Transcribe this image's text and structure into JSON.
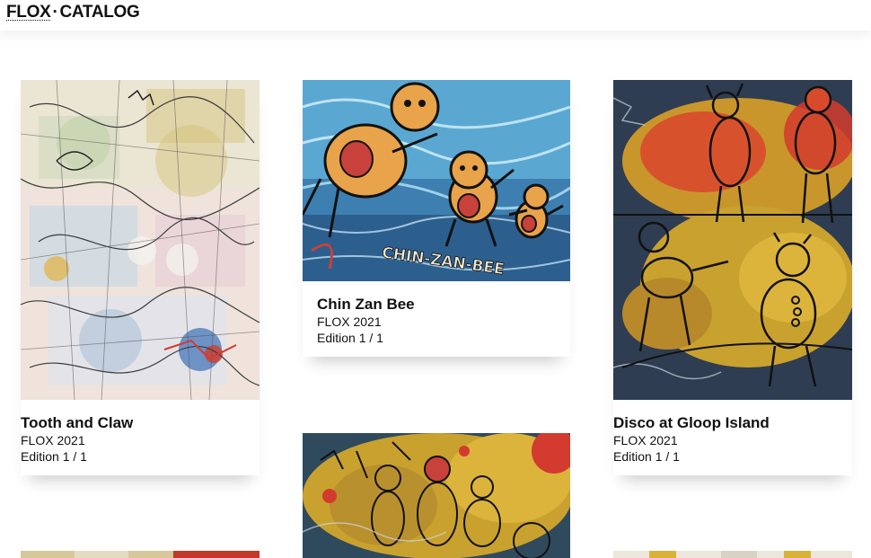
{
  "header": {
    "brand": "FLOX",
    "separator": "·",
    "section": "CATALOG"
  },
  "cards": [
    {
      "title": "Tooth and Claw",
      "artist_year": "FLOX 2021",
      "edition": "Edition 1 / 1"
    },
    {
      "title": "Chin Zan Bee",
      "artist_year": "FLOX 2021",
      "edition": "Edition 1 / 1",
      "art_text": "CHIN-ZAN-BEE"
    },
    {
      "title": "Disco at Gloop Island",
      "artist_year": "FLOX 2021",
      "edition": "Edition 1 / 1"
    }
  ],
  "colors": {
    "background": "#ffffff",
    "text": "#111111"
  }
}
